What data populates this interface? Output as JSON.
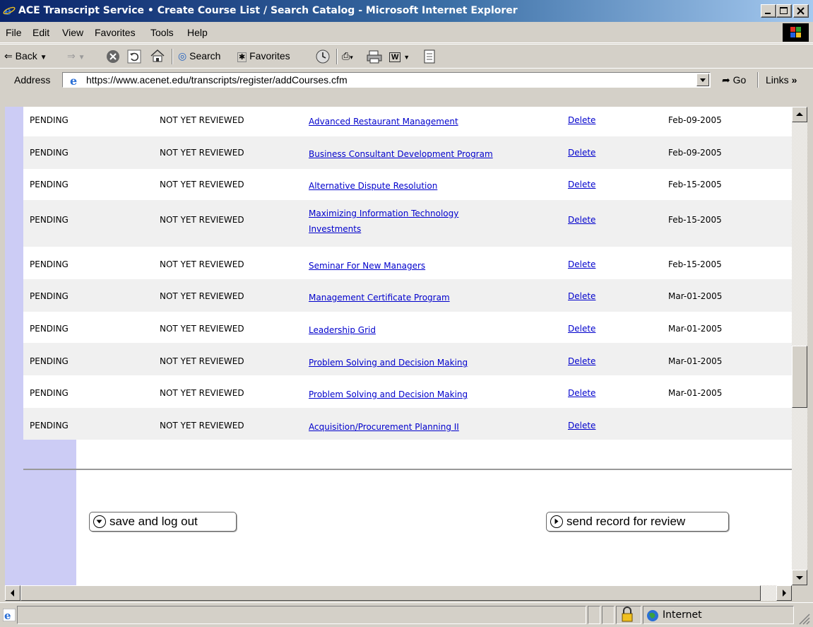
{
  "window": {
    "title": "ACE Transcript Service • Create Course List / Search Catalog - Microsoft Internet Explorer"
  },
  "menu": [
    "File",
    "Edit",
    "View",
    "Favorites",
    "Tools",
    "Help"
  ],
  "toolbar": {
    "back": "Back",
    "search": "Search",
    "favorites": "Favorites"
  },
  "address": {
    "label": "Address",
    "url": "https://www.acenet.edu/transcripts/register/addCourses.cfm",
    "go": "Go",
    "links": "Links"
  },
  "courses": [
    {
      "status": "PENDING",
      "review": "NOT YET REVIEWED",
      "title": "Advanced Restaurant Management",
      "action": "Delete",
      "date": "Feb-09-2005"
    },
    {
      "status": "PENDING",
      "review": "NOT YET REVIEWED",
      "title": "Business Consultant Development Program",
      "action": "Delete",
      "date": "Feb-09-2005"
    },
    {
      "status": "PENDING",
      "review": "NOT YET REVIEWED",
      "title": "Alternative Dispute Resolution",
      "action": "Delete",
      "date": "Feb-15-2005"
    },
    {
      "status": "PENDING",
      "review": "NOT YET REVIEWED",
      "title": "Maximizing Information Technology Investments",
      "action": "Delete",
      "date": "Feb-15-2005"
    },
    {
      "status": "PENDING",
      "review": "NOT YET REVIEWED",
      "title": "Seminar For New Managers",
      "action": "Delete",
      "date": "Feb-15-2005"
    },
    {
      "status": "PENDING",
      "review": "NOT YET REVIEWED",
      "title": "Management Certificate Program",
      "action": "Delete",
      "date": "Mar-01-2005"
    },
    {
      "status": "PENDING",
      "review": "NOT YET REVIEWED",
      "title": "Leadership Grid",
      "action": "Delete",
      "date": "Mar-01-2005"
    },
    {
      "status": "PENDING",
      "review": "NOT YET REVIEWED",
      "title": "Problem Solving and Decision Making",
      "action": "Delete",
      "date": "Mar-01-2005"
    },
    {
      "status": "PENDING",
      "review": "NOT YET REVIEWED",
      "title": "Problem Solving and Decision Making",
      "action": "Delete",
      "date": "Mar-01-2005"
    },
    {
      "status": "PENDING",
      "review": "NOT YET REVIEWED",
      "title": "Acquisition/Procurement Planning II",
      "action": "Delete",
      "date": ""
    }
  ],
  "actions": {
    "save": "save and log out",
    "send": "send record for review"
  },
  "status": {
    "zone": "Internet"
  },
  "colors": {
    "link": "#0000cc",
    "sidebar": "#ccccf5",
    "row_alt": "#f0f0f0",
    "chrome": "#d4d0c8"
  }
}
